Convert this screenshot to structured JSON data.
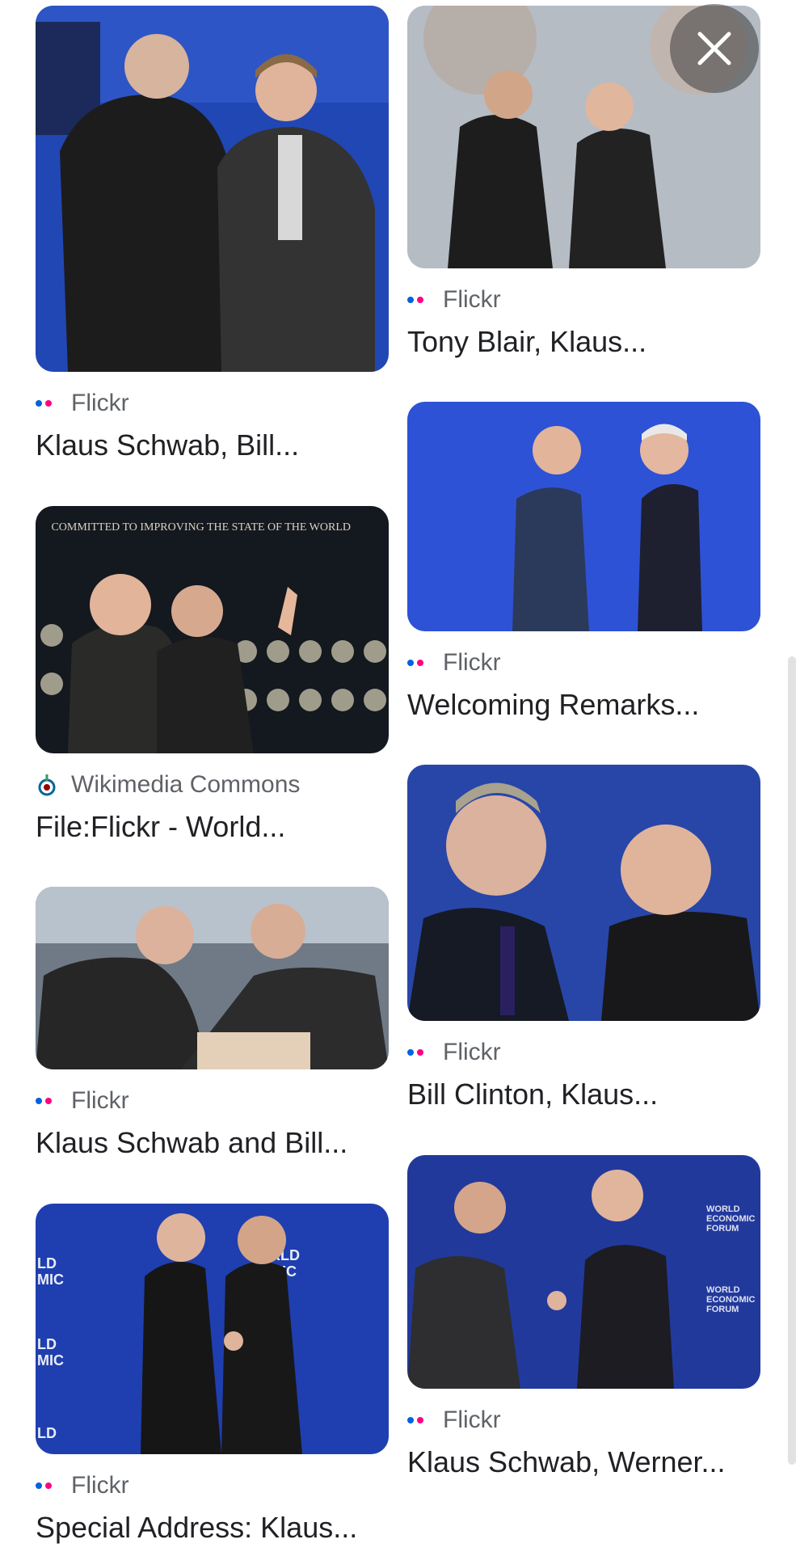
{
  "close_button": {
    "icon": "close-icon"
  },
  "results": [
    {
      "source": "Flickr",
      "source_icon": "flickr-icon",
      "title": "Klaus Schwab, Bill..."
    },
    {
      "source": "Flickr",
      "source_icon": "flickr-icon",
      "title": "Tony Blair, Klaus..."
    },
    {
      "source": "Wikimedia Commons",
      "source_icon": "wikimedia-icon",
      "title": "File:Flickr - World..."
    },
    {
      "source": "Flickr",
      "source_icon": "flickr-icon",
      "title": "Welcoming Remarks..."
    },
    {
      "source": "Flickr",
      "source_icon": "flickr-icon",
      "title": "Klaus Schwab and Bill..."
    },
    {
      "source": "Flickr",
      "source_icon": "flickr-icon",
      "title": "Bill Clinton, Klaus..."
    },
    {
      "source": "Flickr",
      "source_icon": "flickr-icon",
      "title": "Special Address: Klaus..."
    },
    {
      "source": "Flickr",
      "source_icon": "flickr-icon",
      "title": "Klaus Schwab, Werner..."
    }
  ],
  "photo_sign_text": {
    "committed": "COMMITTED TO IMPROVING THE STATE OF THE WORLD",
    "wef": "WORLD ECONOMIC FORUM"
  },
  "colors": {
    "flickr_blue": "#0063dc",
    "flickr_pink": "#ff0084",
    "stage_blue": "#1f3fb0"
  }
}
